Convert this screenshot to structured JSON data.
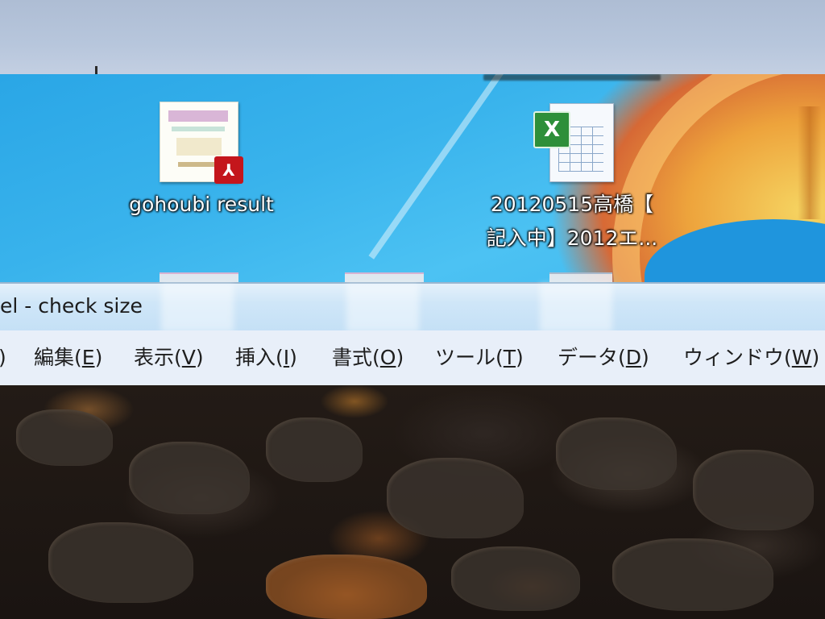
{
  "desktop": {
    "icons": [
      {
        "label": "gohoubi result",
        "type": "pdf-icon"
      },
      {
        "label_line1": "20120515高橋【",
        "label_line2": "記入中】2012エ...",
        "type": "excel-icon"
      }
    ],
    "badge_pdf": "⅄",
    "badge_excel": "X"
  },
  "window": {
    "title": "el - check size",
    "menu": [
      {
        "label": ")"
      },
      {
        "label": "編集(",
        "key": "E",
        "close": ")"
      },
      {
        "label": "表示(",
        "key": "V",
        "close": ")"
      },
      {
        "label": "挿入(",
        "key": "I",
        "close": ")"
      },
      {
        "label": "書式(",
        "key": "O",
        "close": ")"
      },
      {
        "label": "ツール(",
        "key": "T",
        "close": ")"
      },
      {
        "label": "データ(",
        "key": "D",
        "close": ")"
      },
      {
        "label": "ウィンドウ(",
        "key": "W",
        "close": ")"
      }
    ]
  },
  "colors": {
    "desktop_blue": "#39b3ec",
    "titlebar": "#cfe6f8",
    "menubar": "#e8eff9",
    "pdf_red": "#c4161c",
    "excel_green": "#2e8f3a"
  }
}
